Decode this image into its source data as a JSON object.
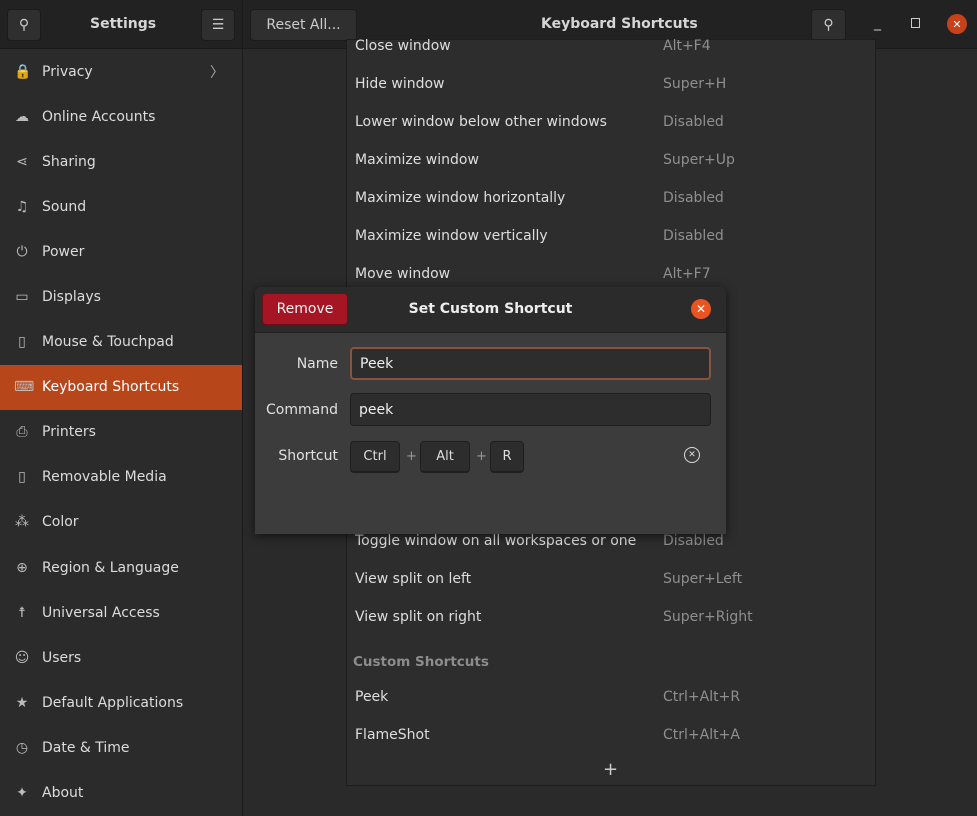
{
  "header": {
    "sidebar_title": "Settings",
    "reset_label": "Reset All...",
    "title": "Keyboard Shortcuts"
  },
  "sidebar": {
    "items": [
      {
        "label": "Privacy",
        "icon": "lock-icon",
        "glyph": "🔒",
        "chevron": "〉"
      },
      {
        "label": "Online Accounts",
        "icon": "cloud-icon",
        "glyph": "☁"
      },
      {
        "label": "Sharing",
        "icon": "share-icon",
        "glyph": "⋖"
      },
      {
        "label": "Sound",
        "icon": "music-note-icon",
        "glyph": "♫"
      },
      {
        "label": "Power",
        "icon": "power-icon",
        "glyph": "⏻"
      },
      {
        "label": "Displays",
        "icon": "display-icon",
        "glyph": "▭"
      },
      {
        "label": "Mouse & Touchpad",
        "icon": "mouse-icon",
        "glyph": "▯"
      },
      {
        "label": "Keyboard Shortcuts",
        "icon": "keyboard-icon",
        "glyph": "⌨",
        "active": true
      },
      {
        "label": "Printers",
        "icon": "printer-icon",
        "glyph": "⎙"
      },
      {
        "label": "Removable Media",
        "icon": "usb-drive-icon",
        "glyph": "▯"
      },
      {
        "label": "Color",
        "icon": "color-icon",
        "glyph": "⁂"
      },
      {
        "label": "Region & Language",
        "icon": "globe-icon",
        "glyph": "⊕"
      },
      {
        "label": "Universal Access",
        "icon": "accessibility-icon",
        "glyph": "☨"
      },
      {
        "label": "Users",
        "icon": "users-icon",
        "glyph": "☺"
      },
      {
        "label": "Default Applications",
        "icon": "star-icon",
        "glyph": "★"
      },
      {
        "label": "Date & Time",
        "icon": "clock-icon",
        "glyph": "◷"
      },
      {
        "label": "About",
        "icon": "sparkle-icon",
        "glyph": "✦"
      }
    ]
  },
  "shortcuts": [
    {
      "name": "Close window",
      "value": "Alt+F4"
    },
    {
      "name": "Hide window",
      "value": "Super+H"
    },
    {
      "name": "Lower window below other windows",
      "value": "Disabled"
    },
    {
      "name": "Maximize window",
      "value": "Super+Up"
    },
    {
      "name": "Maximize window horizontally",
      "value": "Disabled"
    },
    {
      "name": "Maximize window vertically",
      "value": "Disabled"
    },
    {
      "name": "Move window",
      "value": "Alt+F7"
    }
  ],
  "shortcuts_lower": [
    {
      "name": "Toggle window on all workspaces or one",
      "value": "Disabled"
    },
    {
      "name": "View split on left",
      "value": "Super+Left"
    },
    {
      "name": "View split on right",
      "value": "Super+Right"
    }
  ],
  "custom": {
    "title": "Custom Shortcuts",
    "items": [
      {
        "name": "Peek",
        "value": "Ctrl+Alt+R"
      },
      {
        "name": "FlameShot",
        "value": "Ctrl+Alt+A"
      }
    ],
    "add": "+"
  },
  "dialog": {
    "title": "Set Custom Shortcut",
    "remove_label": "Remove",
    "name_label": "Name",
    "name_value": "Peek",
    "command_label": "Command",
    "command_value": "peek",
    "shortcut_label": "Shortcut",
    "keys": [
      "Ctrl",
      "Alt",
      "R"
    ],
    "plus": "+",
    "accent": "#e95420",
    "remove_color": "#a51524"
  }
}
